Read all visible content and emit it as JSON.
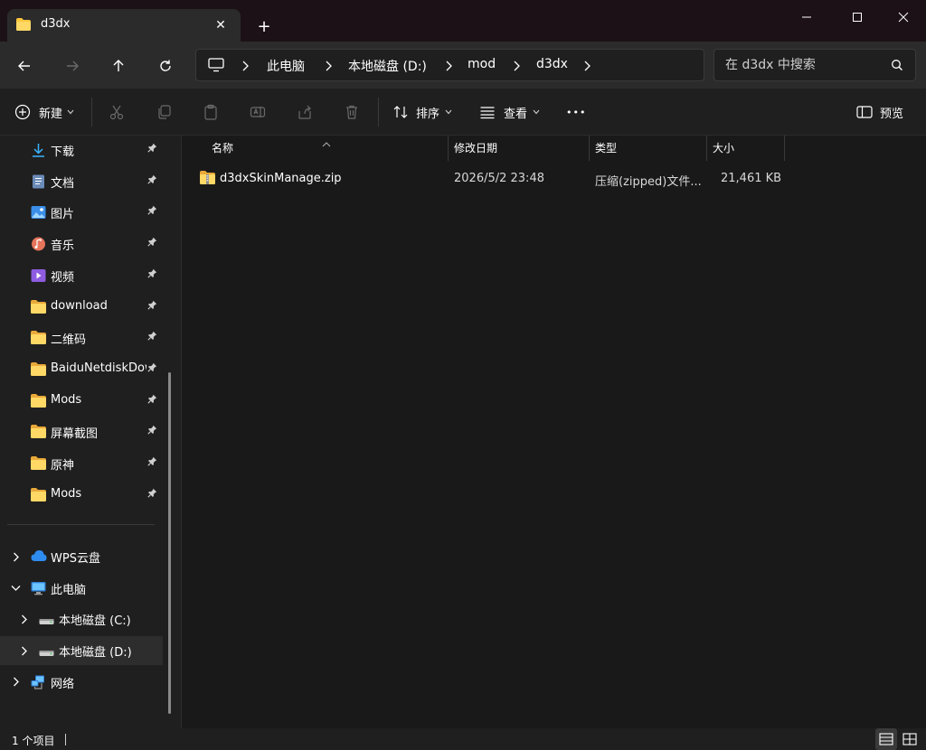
{
  "tab": {
    "title": "d3dx",
    "close_glyph": "✕",
    "new_glyph": "+"
  },
  "window": {
    "minimize_glyph": "—",
    "maximize_glyph": "☐",
    "close_glyph": "✕"
  },
  "breadcrumbs": [
    "此电脑",
    "本地磁盘 (D:)",
    "mod",
    "d3dx"
  ],
  "search": {
    "placeholder": "在 d3dx 中搜索"
  },
  "toolbar": {
    "new_label": "新建",
    "sort_label": "排序",
    "view_label": "查看",
    "preview_label": "预览",
    "more_glyph": "•••"
  },
  "sidebar": {
    "quick_access": [
      {
        "label": "下载",
        "icon": "download-icon"
      },
      {
        "label": "文档",
        "icon": "document-icon"
      },
      {
        "label": "图片",
        "icon": "picture-icon"
      },
      {
        "label": "音乐",
        "icon": "music-icon"
      },
      {
        "label": "视频",
        "icon": "video-icon"
      },
      {
        "label": "download",
        "icon": "folder-icon"
      },
      {
        "label": "二维码",
        "icon": "folder-icon"
      },
      {
        "label": "BaiduNetdiskDownload",
        "icon": "folder-icon"
      },
      {
        "label": "Mods",
        "icon": "folder-icon"
      },
      {
        "label": "屏幕截图",
        "icon": "folder-icon"
      },
      {
        "label": "原神",
        "icon": "folder-icon"
      },
      {
        "label": "Mods",
        "icon": "folder-icon"
      }
    ],
    "tree": [
      {
        "label": "WPS云盘",
        "icon": "cloud-icon",
        "expanded": false,
        "level": 0
      },
      {
        "label": "此电脑",
        "icon": "computer-icon",
        "expanded": true,
        "level": 0
      },
      {
        "label": "本地磁盘 (C:)",
        "icon": "drive-icon",
        "expanded": false,
        "level": 1
      },
      {
        "label": "本地磁盘 (D:)",
        "icon": "drive-icon",
        "expanded": false,
        "level": 1,
        "selected": true
      },
      {
        "label": "网络",
        "icon": "network-icon",
        "expanded": false,
        "level": 0
      }
    ]
  },
  "columns": {
    "name": "名称",
    "modified": "修改日期",
    "type": "类型",
    "size": "大小"
  },
  "files": [
    {
      "name": "d3dxSkinManage.zip",
      "modified": "2026/5/2 23:48",
      "type": "压缩(zipped)文件...",
      "size": "21,461 KB"
    }
  ],
  "status": {
    "item_count": "1 个项目"
  },
  "colors": {
    "accent": "#ffc83d",
    "background": "#191919",
    "titlebar": "#1c1116"
  }
}
